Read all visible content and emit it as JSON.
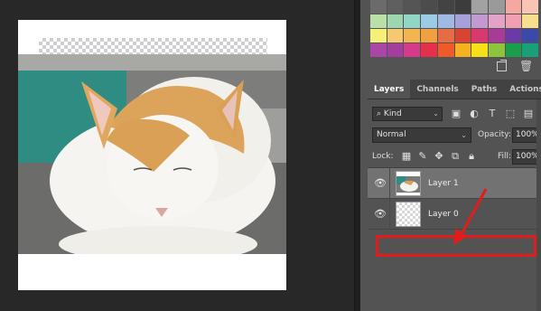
{
  "swatches": [
    "#6b6b6b",
    "#5f5f5f",
    "#555555",
    "#4c4c4c",
    "#434343",
    "#3c3c3c",
    "#a2a2a2",
    "#9a9a9a",
    "#f6a8a0",
    "#f8c4b4",
    "#b8e0a8",
    "#9ed6b0",
    "#92d6c8",
    "#9acce6",
    "#a0b8e4",
    "#a8a0d8",
    "#c29ad0",
    "#e4a2c8",
    "#f0a0b0",
    "#f6e08e",
    "#f5f07a",
    "#f6c870",
    "#f4b452",
    "#f0a040",
    "#e76c44",
    "#d84434",
    "#d83a70",
    "#a83a98",
    "#6a3aa6",
    "#3a4aa8",
    "#aa46a6",
    "#a43e9e",
    "#d63a8a",
    "#e4304a",
    "#f05a28",
    "#f6b020",
    "#f8e018",
    "#8cc43c",
    "#1a9e4c",
    "#1aa078"
  ],
  "panel": {
    "tabs": [
      {
        "label": "Layers"
      },
      {
        "label": "Channels"
      },
      {
        "label": "Paths"
      },
      {
        "label": "Actions"
      }
    ],
    "filter": {
      "kind_label": "Kind",
      "search_glyph": "⌕"
    },
    "blend_mode": "Normal",
    "opacity_label": "Opacity:",
    "opacity_value": "100%",
    "lock_label": "Lock:",
    "fill_label": "Fill:",
    "fill_value": "100%",
    "layers": [
      {
        "name": "Layer 1",
        "visible": true,
        "selected": true
      },
      {
        "name": "Layer 0",
        "visible": true,
        "selected": false
      }
    ]
  },
  "colors": {
    "accent_annotation": "#e41b1b",
    "panel_bg": "#535353",
    "canvas_bg": "#282828"
  }
}
